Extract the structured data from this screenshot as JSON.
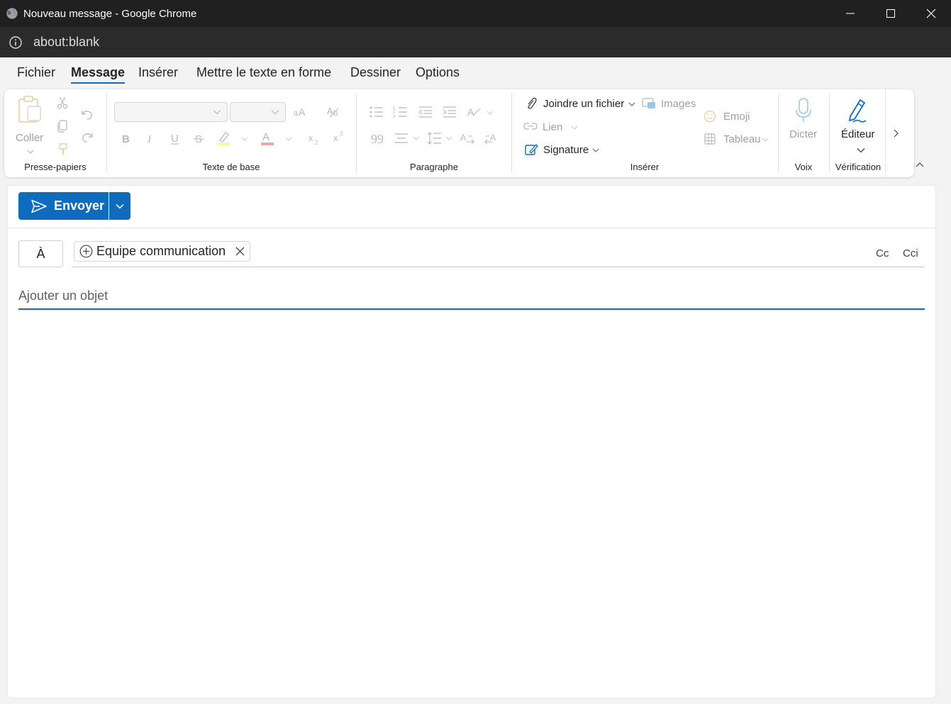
{
  "window": {
    "title": "Nouveau message - Google Chrome",
    "url": "about:blank"
  },
  "tabs": [
    {
      "label": "Fichier",
      "active": false
    },
    {
      "label": "Message",
      "active": true
    },
    {
      "label": "Insérer",
      "active": false
    },
    {
      "label": "Mettre le texte en forme",
      "active": false
    },
    {
      "label": "Dessiner",
      "active": false
    },
    {
      "label": "Options",
      "active": false
    }
  ],
  "ribbon": {
    "clipboard": {
      "label": "Presse-papiers",
      "paste": "Coller"
    },
    "basic_text": {
      "label": "Texte de base"
    },
    "paragraph": {
      "label": "Paragraphe"
    },
    "insert": {
      "label": "Insérer",
      "attach": "Joindre un fichier",
      "images": "Images",
      "link": "Lien",
      "emoji": "Emoji",
      "table": "Tableau",
      "signature": "Signature"
    },
    "voice": {
      "label": "Voix",
      "dictate": "Dicter"
    },
    "proofing": {
      "label": "Vérification",
      "editor": "Éditeur"
    }
  },
  "compose": {
    "send_label": "Envoyer",
    "to_label": "À",
    "recipient": "Equipe communication",
    "cc_label": "Cc",
    "bcc_label": "Cci",
    "subject_placeholder": "Ajouter un objet"
  },
  "colors": {
    "accent": "#0f6cbd",
    "titlebar": "#202020",
    "addressbar": "#2b2b2b"
  }
}
